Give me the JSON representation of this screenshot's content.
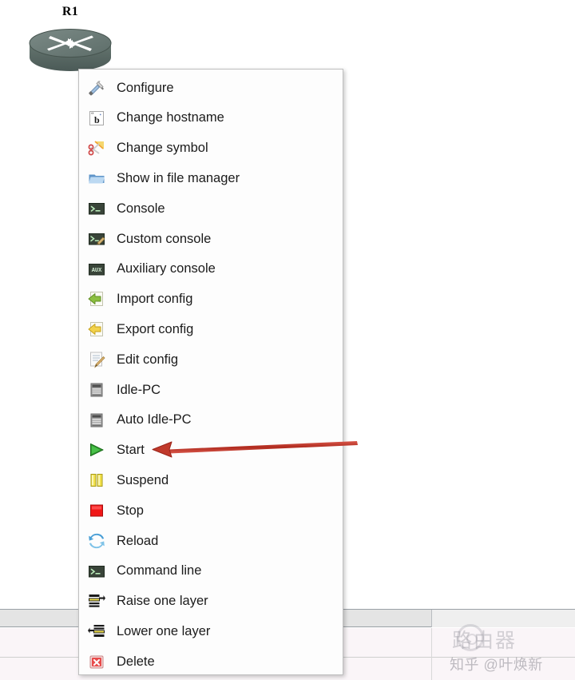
{
  "canvas": {
    "node": {
      "label": "R1",
      "symbol_icon": "cisco-router-icon"
    }
  },
  "context_menu": {
    "items": [
      {
        "label": "Configure",
        "icon": "configure-tools-icon"
      },
      {
        "label": "Change hostname",
        "icon": "rename-text-icon"
      },
      {
        "label": "Change symbol",
        "icon": "scissors-symbol-icon"
      },
      {
        "label": "Show in file manager",
        "icon": "folder-icon"
      },
      {
        "label": "Console",
        "icon": "console-terminal-icon"
      },
      {
        "label": "Custom console",
        "icon": "custom-console-icon"
      },
      {
        "label": "Auxiliary console",
        "icon": "auxiliary-console-icon"
      },
      {
        "label": "Import config",
        "icon": "import-arrow-icon"
      },
      {
        "label": "Export config",
        "icon": "export-arrow-icon"
      },
      {
        "label": "Edit config",
        "icon": "edit-pencil-icon"
      },
      {
        "label": "Idle-PC",
        "icon": "server-rack-icon"
      },
      {
        "label": "Auto Idle-PC",
        "icon": "server-rack-icon"
      },
      {
        "label": "Start",
        "icon": "play-green-icon"
      },
      {
        "label": "Suspend",
        "icon": "pause-yellow-icon"
      },
      {
        "label": "Stop",
        "icon": "stop-red-icon"
      },
      {
        "label": "Reload",
        "icon": "reload-refresh-icon"
      },
      {
        "label": "Command line",
        "icon": "command-line-icon"
      },
      {
        "label": "Raise one layer",
        "icon": "raise-layer-icon"
      },
      {
        "label": "Lower one layer",
        "icon": "lower-layer-icon"
      },
      {
        "label": "Delete",
        "icon": "delete-x-icon"
      }
    ]
  },
  "annotation": {
    "arrow_icon": "red-arrow-pointing-left",
    "points_to": "Start",
    "color": "#c0392b"
  },
  "watermark": {
    "brand": "路由器",
    "author": "知乎 @叶焕新",
    "logo_icon": "circle-logo-icon"
  },
  "colors": {
    "menu_background": "#fdfdfd",
    "menu_border": "#bfbfbf",
    "text": "#1b1b1b",
    "router_body": "#5f6f6c",
    "accent_red": "#c0392b",
    "start_green": "#27a327",
    "stop_red": "#f01616",
    "suspend_yellow": "#f2e14c"
  }
}
